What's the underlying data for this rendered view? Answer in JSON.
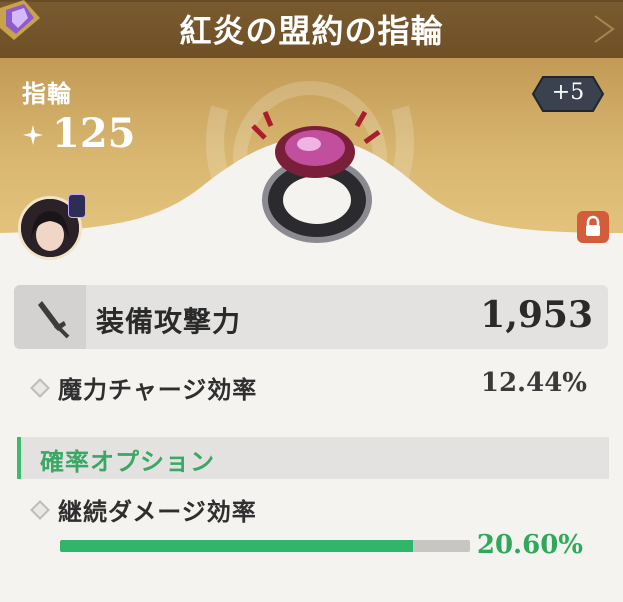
{
  "item": {
    "title": "紅炎の盟約の指輪",
    "type": "指輪",
    "score": "125",
    "level": "+5"
  },
  "main_stat": {
    "label": "装備攻撃力",
    "value": "1,953"
  },
  "sub_stat": {
    "label": "魔力チャージ効率",
    "value": "12.44%"
  },
  "options": {
    "header": "確率オプション",
    "items": [
      {
        "label": "継続ダメージ効率",
        "value": "20.60%",
        "fill_percent": 86
      }
    ]
  },
  "icons": {
    "score": "sparkle-icon",
    "main_stat": "sword-icon",
    "lock": "lock-icon",
    "bullet": "diamond-bullet-icon"
  },
  "colors": {
    "title_bar": "#6f4f25",
    "hero_gold": "#d8b66f",
    "accent_green": "#2fb669",
    "lock_red": "#d55c3a"
  }
}
